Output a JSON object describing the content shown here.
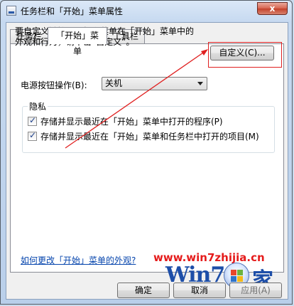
{
  "window": {
    "title": "任务栏和「开始」菜单属性",
    "close_glyph": "x"
  },
  "tabs": [
    {
      "label": "任务栏"
    },
    {
      "label": "「开始」菜单",
      "active": true
    },
    {
      "label": "工具栏"
    }
  ],
  "start_menu": {
    "description_line1": "要自定义链接、图标和菜单在「开始」菜单中的",
    "description_line2": "外观和行为，请单击“自定义”。",
    "customize_button": "自定义(C)...",
    "power_label": "电源按钮操作(B):",
    "power_value": "关机",
    "privacy_group": "隐私",
    "checkboxes": [
      {
        "label": "存储并显示最近在「开始」菜单中打开的程序(P)",
        "checked": true
      },
      {
        "label": "存储并显示最近在「开始」菜单和任务栏中打开的项目(M)",
        "checked": true
      }
    ],
    "help_link": "如何更改「开始」菜单的外观?"
  },
  "footer": {
    "ok_label": "确定",
    "cancel_label": "取消",
    "apply_label": "应用(A)"
  },
  "watermark": {
    "url": "www.win7zhijia.cn",
    "logo_text": "Win7",
    "logo_suffix": "家"
  },
  "annotation": {
    "color": "#e02020"
  }
}
